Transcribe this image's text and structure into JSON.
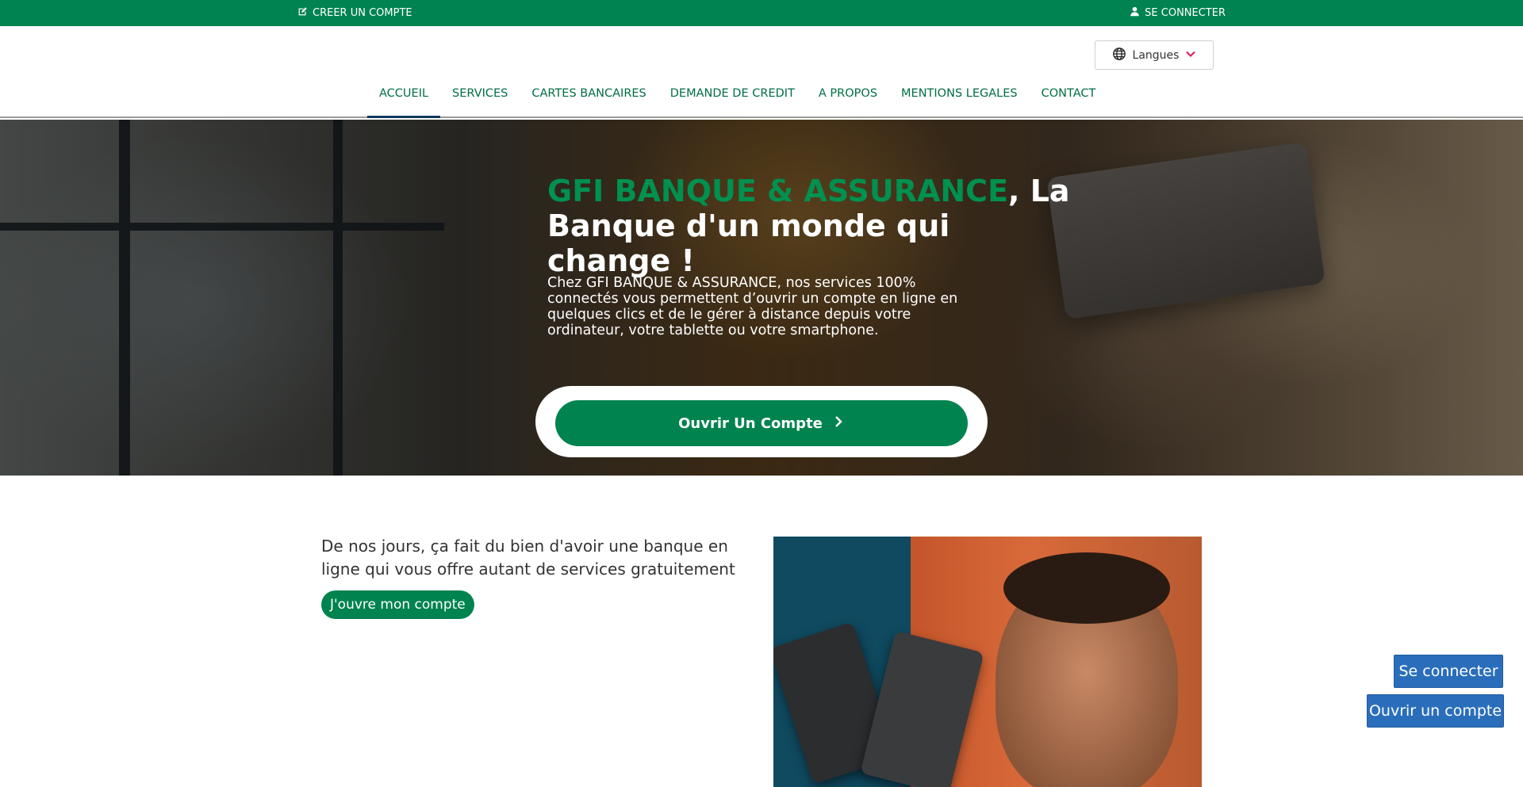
{
  "topbar": {
    "create_account": "CREER UN COMPTE",
    "login": "SE CONNECTER"
  },
  "header": {
    "language_button": "Langues",
    "nav": [
      {
        "label": "ACCUEIL",
        "active": true
      },
      {
        "label": "SERVICES",
        "active": false
      },
      {
        "label": "CARTES BANCAIRES",
        "active": false
      },
      {
        "label": "DEMANDE DE CREDIT",
        "active": false
      },
      {
        "label": "A PROPOS",
        "active": false
      },
      {
        "label": "MENTIONS LEGALES",
        "active": false
      },
      {
        "label": "CONTACT",
        "active": false
      }
    ]
  },
  "hero": {
    "title_brand": "GFI BANQUE & ASSURANCE",
    "title_rest": ", La Banque d'un monde qui change !",
    "description": "Chez GFI BANQUE & ASSURANCE, nos services 100% connectés vous permettent d’ouvrir un compte en ligne en quelques clics et de le gérer à distance depuis votre ordinateur, votre tablette ou votre smartphone.",
    "cta_label": "Ouvrir Un Compte"
  },
  "section": {
    "text": "De nos jours, ça fait du bien d'avoir une banque en ligne qui vous offre autant de services gratuitement",
    "cta_label": "J'ouvre mon compte"
  },
  "floating": {
    "login": "Se connecter",
    "open_account": "Ouvrir un compte"
  },
  "colors": {
    "brand_green": "#00834f",
    "nav_text": "#006e44",
    "floating_blue": "#2a6ebb"
  }
}
